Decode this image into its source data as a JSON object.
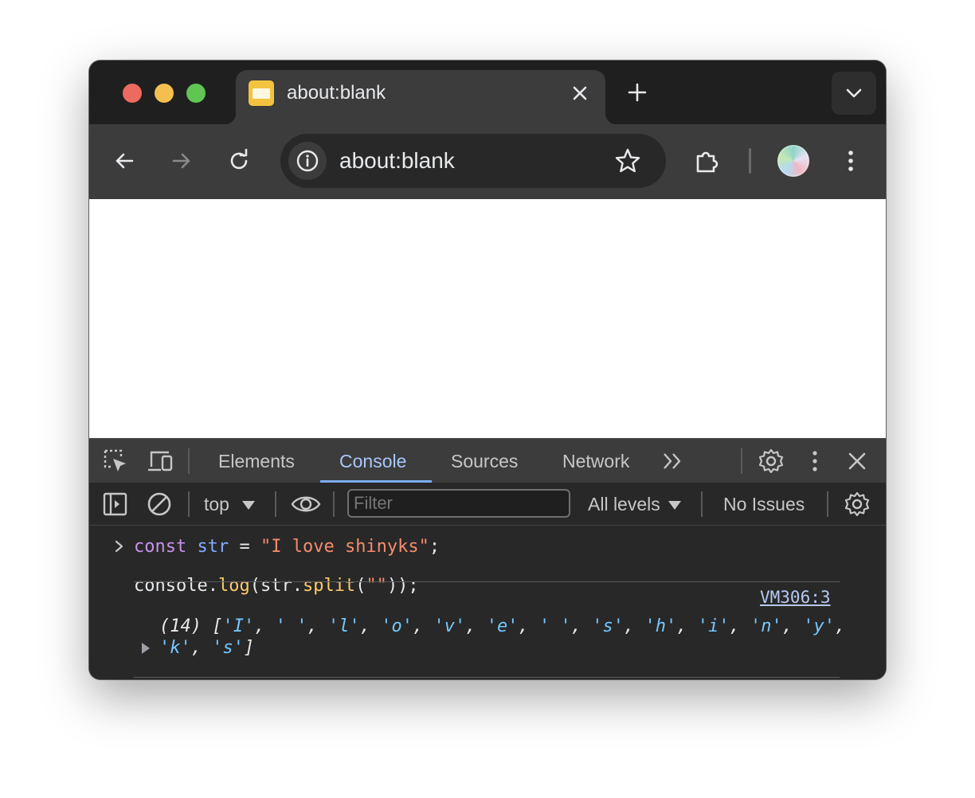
{
  "browser": {
    "tab": {
      "title": "about:blank"
    },
    "address_bar": {
      "url": "about:blank"
    }
  },
  "devtools": {
    "tabs": [
      {
        "label": "Elements"
      },
      {
        "label": "Console"
      },
      {
        "label": "Sources"
      },
      {
        "label": "Network"
      }
    ],
    "active_tab": "Console",
    "console_toolbar": {
      "context": "top",
      "filter_placeholder": "Filter",
      "levels": "All levels",
      "issues": "No Issues"
    },
    "console": {
      "input_line1": {
        "kw": "const",
        "var": "str",
        "op": " = ",
        "str": "\"I love shinyks\"",
        "end": ";"
      },
      "input_line2": {
        "obj": "console.",
        "fn1": "log",
        "mid": "(str.",
        "fn2": "split",
        "open": "(",
        "str": "\"\"",
        "close": "));"
      },
      "output": {
        "source": "VM306:3",
        "count": "(14)",
        "items": [
          "'I'",
          "' '",
          "'l'",
          "'o'",
          "'v'",
          "'e'",
          "' '",
          "'s'",
          "'h'",
          "'i'",
          "'n'",
          "'y'",
          "'k'",
          "'s'"
        ]
      }
    }
  },
  "colors": {
    "devtools_accent": "#7cacf8",
    "keyword": "#c792ea",
    "string": "#f78c6c",
    "output_string": "#74c8ff"
  },
  "icons": [
    "close-icon",
    "plus-icon",
    "chevron-down-icon",
    "back-arrow-icon",
    "forward-arrow-icon",
    "reload-icon",
    "info-icon",
    "star-icon",
    "extensions-icon",
    "more-vert-icon",
    "inspect-icon",
    "device-toolbar-icon",
    "chevrons-more-icon",
    "gear-icon",
    "sidebar-icon",
    "clear-console-icon",
    "eye-icon",
    "caret-down-icon"
  ]
}
